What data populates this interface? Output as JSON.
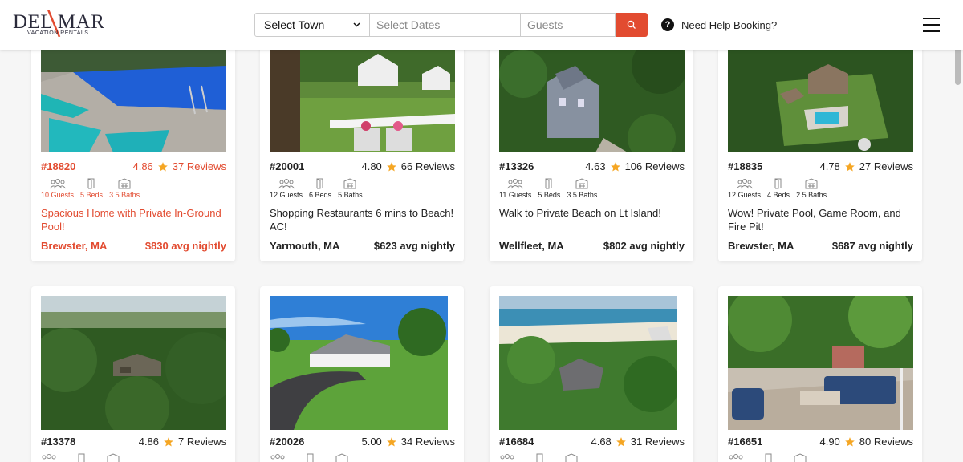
{
  "header": {
    "logo_text": "DEL MAR",
    "logo_sub": "VACATION RENTALS",
    "select_town": "Select Town",
    "dates_placeholder": "Select Dates",
    "guests_placeholder": "Guests",
    "help_text": "Need Help Booking?"
  },
  "colors": {
    "accent": "#e24b30",
    "star": "#f5a623"
  },
  "listings": [
    {
      "id": "#18820",
      "rating": "4.86",
      "reviews": "37 Reviews",
      "guests": "10 Guests",
      "beds": "5 Beds",
      "baths": "3.5 Baths",
      "title": "Spacious Home with Private In-Ground Pool!",
      "town": "Brewster, MA",
      "price": "$830 avg nightly"
    },
    {
      "id": "#20001",
      "rating": "4.80",
      "reviews": "66 Reviews",
      "guests": "12 Guests",
      "beds": "6 Beds",
      "baths": "5 Baths",
      "title": "Shopping Restaurants 6 mins to Beach! AC!",
      "town": "Yarmouth, MA",
      "price": "$623 avg nightly"
    },
    {
      "id": "#13326",
      "rating": "4.63",
      "reviews": "106 Reviews",
      "guests": "11 Guests",
      "beds": "5 Beds",
      "baths": "3.5 Baths",
      "title": "Walk to Private Beach on Lt Island!",
      "town": "Wellfleet, MA",
      "price": "$802 avg nightly"
    },
    {
      "id": "#18835",
      "rating": "4.78",
      "reviews": "27 Reviews",
      "guests": "12 Guests",
      "beds": "4 Beds",
      "baths": "2.5 Baths",
      "title": "Wow! Private Pool, Game Room, and Fire Pit!",
      "town": "Brewster, MA",
      "price": "$687 avg nightly"
    },
    {
      "id": "#13378",
      "rating": "4.86",
      "reviews": "7 Reviews"
    },
    {
      "id": "#20026",
      "rating": "5.00",
      "reviews": "34 Reviews"
    },
    {
      "id": "#16684",
      "rating": "4.68",
      "reviews": "31 Reviews"
    },
    {
      "id": "#16651",
      "rating": "4.90",
      "reviews": "80 Reviews"
    }
  ]
}
